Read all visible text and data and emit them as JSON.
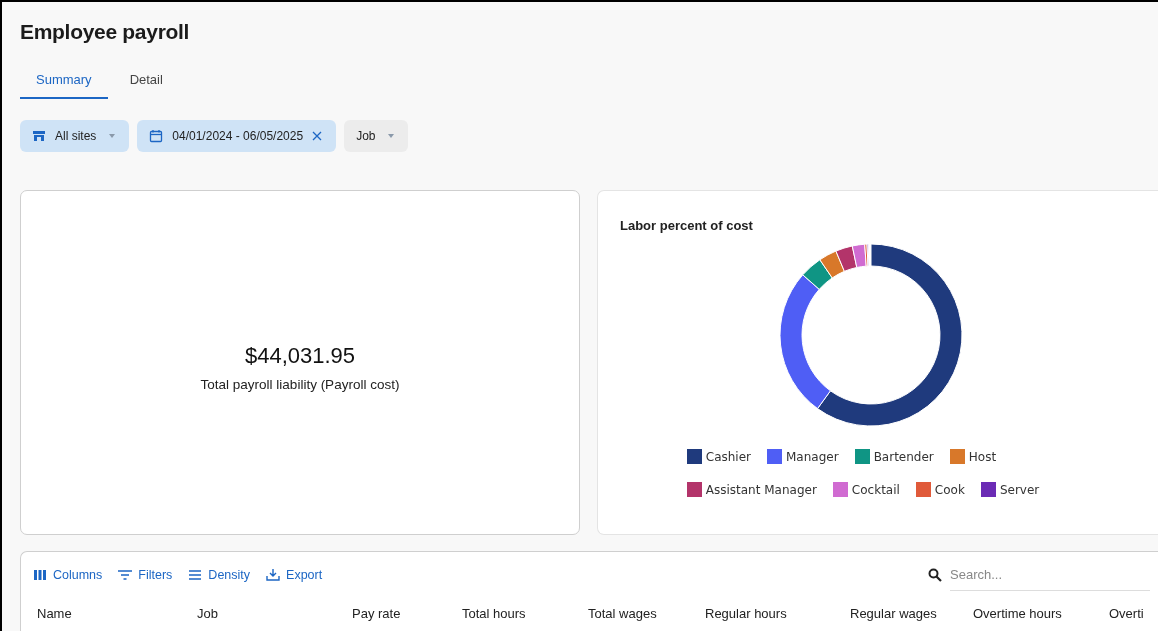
{
  "page": {
    "title": "Employee payroll"
  },
  "tabs": [
    {
      "label": "Summary",
      "selected": true
    },
    {
      "label": "Detail",
      "selected": false
    }
  ],
  "filters": [
    {
      "kind": "sites",
      "label": "All sites",
      "active": true
    },
    {
      "kind": "dates",
      "label": "04/01/2024 - 06/05/2025",
      "active": true
    },
    {
      "kind": "job",
      "label": "Job",
      "active": false
    }
  ],
  "total_card": {
    "value": "$44,031.95",
    "label": "Total payroll liability (Payroll cost)"
  },
  "chart_card": {
    "title": "Labor percent of cost",
    "legend": [
      {
        "label": "Cashier",
        "color": "#1f3a7d"
      },
      {
        "label": "Manager",
        "color": "#4f5ef5"
      },
      {
        "label": "Bartender",
        "color": "#0f9584"
      },
      {
        "label": "Host",
        "color": "#d8782a"
      },
      {
        "label": "Assistant Manager",
        "color": "#b3346a"
      },
      {
        "label": "Cocktail",
        "color": "#d06bd1"
      },
      {
        "label": "Cook",
        "color": "#e05a3a"
      },
      {
        "label": "Server",
        "color": "#6b2bb5"
      }
    ]
  },
  "table": {
    "toolbar": [
      {
        "kind": "columns",
        "label": "Columns"
      },
      {
        "kind": "filters",
        "label": "Filters"
      },
      {
        "kind": "density",
        "label": "Density"
      },
      {
        "kind": "export",
        "label": "Export"
      }
    ],
    "search": {
      "placeholder": "Search..."
    },
    "columns": [
      "Name",
      "Job",
      "Pay rate",
      "Total hours",
      "Total wages",
      "Regular hours",
      "Regular wages",
      "Overtime hours",
      "Overti"
    ]
  }
}
